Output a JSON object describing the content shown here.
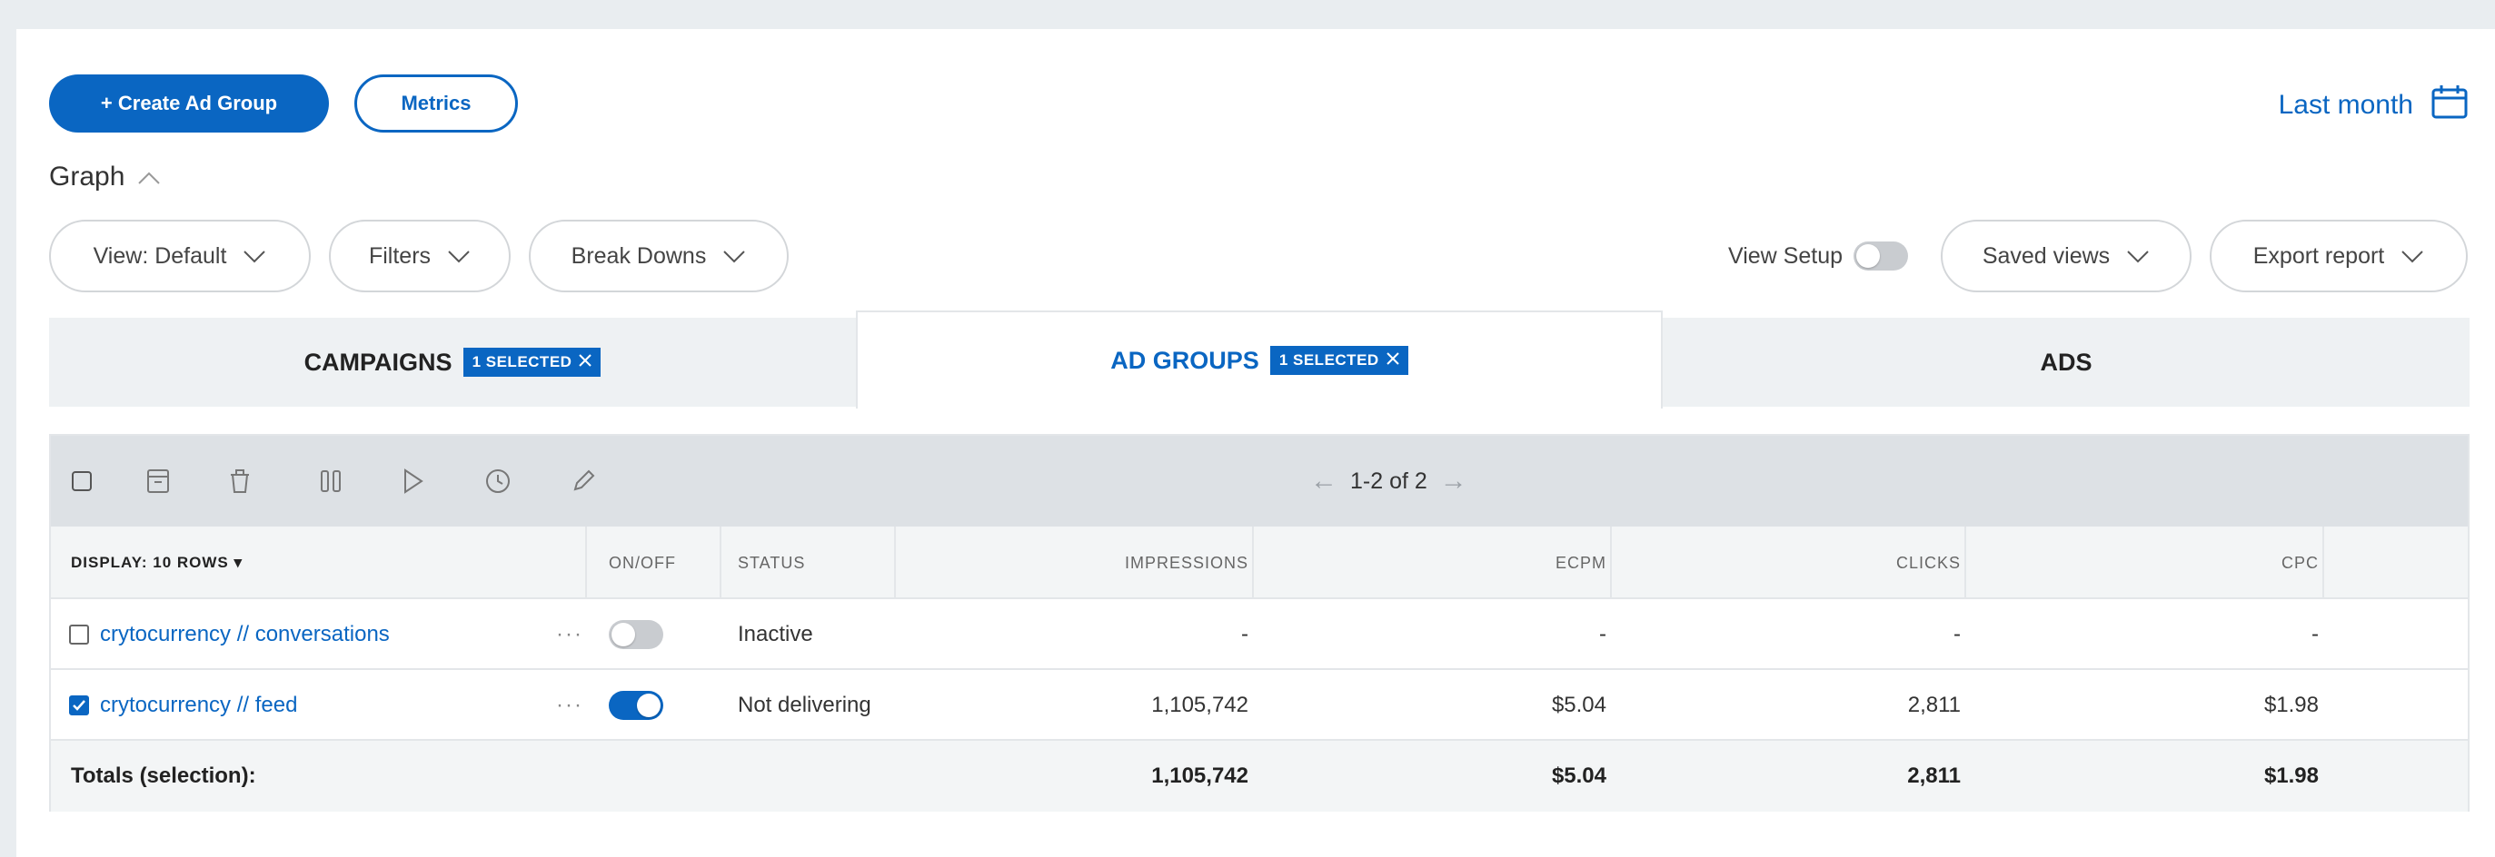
{
  "header": {
    "create_label": "+ Create Ad Group",
    "metrics_label": "Metrics",
    "date_range": "Last month",
    "date_icon": "calendar-icon",
    "graph_label": "Graph"
  },
  "filters": {
    "view_label": "View: Default",
    "filters_label": "Filters",
    "breakdowns_label": "Break Downs",
    "view_setup_label": "View Setup",
    "view_setup_state": "off",
    "saved_views_label": "Saved views",
    "export_label": "Export report"
  },
  "tabs": [
    {
      "label": "CAMPAIGNS",
      "badge": "1 SELECTED",
      "active": false
    },
    {
      "label": "AD GROUPS",
      "badge": "1 SELECTED",
      "active": true
    },
    {
      "label": "ADS",
      "badge": "",
      "active": false
    }
  ],
  "toolbar": {
    "icons": [
      "checkbox-icon",
      "archive-icon",
      "trash-icon",
      "pause-icon",
      "play-icon",
      "clock-icon",
      "pencil-icon"
    ],
    "pagination": "1-2 of 2"
  },
  "table": {
    "columns": {
      "display": "DISPLAY: 10 ROWS ▾",
      "onoff": "ON/OFF",
      "status": "STATUS",
      "impressions": "IMPRESSIONS",
      "ecpm": "ECPM",
      "clicks": "CLICKS",
      "cpc": "CPC"
    },
    "rows": [
      {
        "name": "crytocurrency // conversations",
        "checked": false,
        "on": false,
        "status": "Inactive",
        "impressions": "-",
        "ecpm": "-",
        "clicks": "-",
        "cpc": "-"
      },
      {
        "name": "crytocurrency // feed",
        "checked": true,
        "on": true,
        "status": "Not delivering",
        "impressions": "1,105,742",
        "ecpm": "$5.04",
        "clicks": "2,811",
        "cpc": "$1.98"
      }
    ],
    "totals": {
      "label": "Totals (selection):",
      "impressions": "1,105,742",
      "ecpm": "$5.04",
      "clicks": "2,811",
      "cpc": "$1.98"
    }
  },
  "colors": {
    "accent": "#0a66c2",
    "page_bg": "#e9edf0",
    "toolbar_bg": "#dde1e5"
  }
}
